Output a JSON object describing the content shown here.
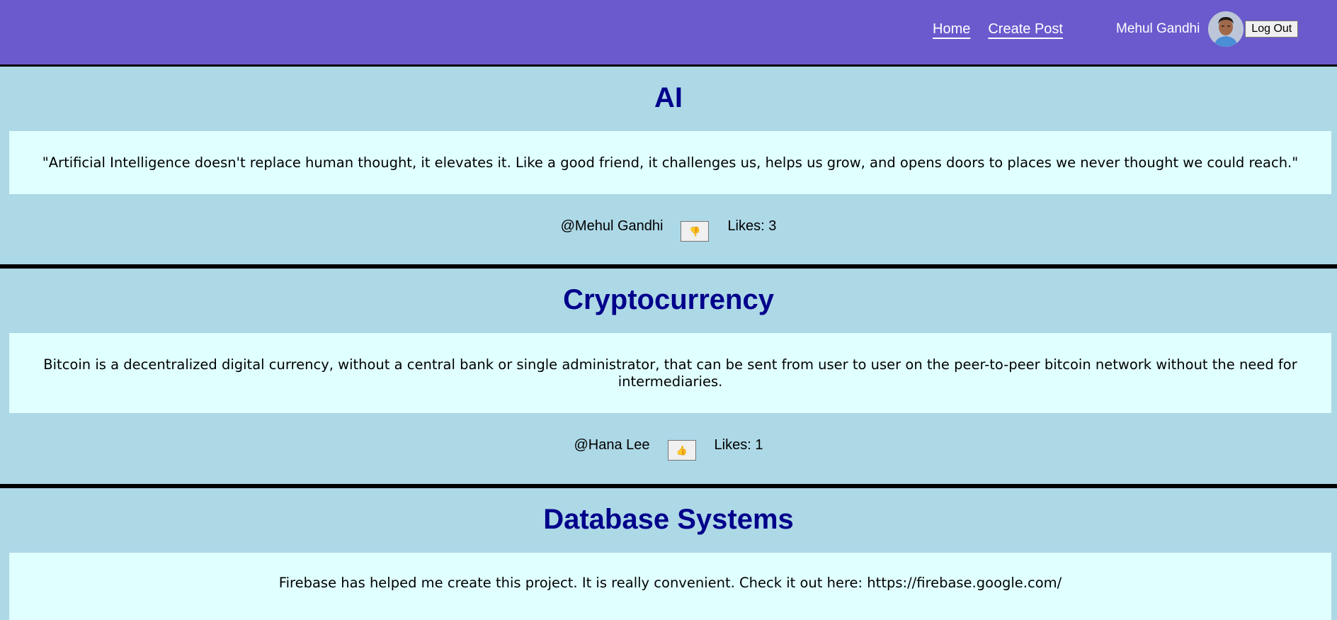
{
  "nav": {
    "home": "Home",
    "create_post": "Create Post",
    "user_name": "Mehul Gandhi",
    "logout": "Log Out"
  },
  "posts": [
    {
      "title": "AI",
      "text": "\"Artificial Intelligence doesn't replace human thought, it elevates it. Like a good friend, it challenges us, helps us grow, and opens doors to places we never thought we could reach.\"",
      "author": "@Mehul Gandhi",
      "like_icon": "👎",
      "likes": "Likes: 3"
    },
    {
      "title": "Cryptocurrency",
      "text": "Bitcoin is a decentralized digital currency, without a central bank or single administrator, that can be sent from user to user on the peer-to-peer bitcoin network without the need for intermediaries.",
      "author": "@Hana Lee",
      "like_icon": "👍",
      "likes": "Likes: 1"
    },
    {
      "title": "Database Systems",
      "text": "Firebase has helped me create this project. It is really convenient. Check it out here: https://firebase.google.com/"
    }
  ]
}
